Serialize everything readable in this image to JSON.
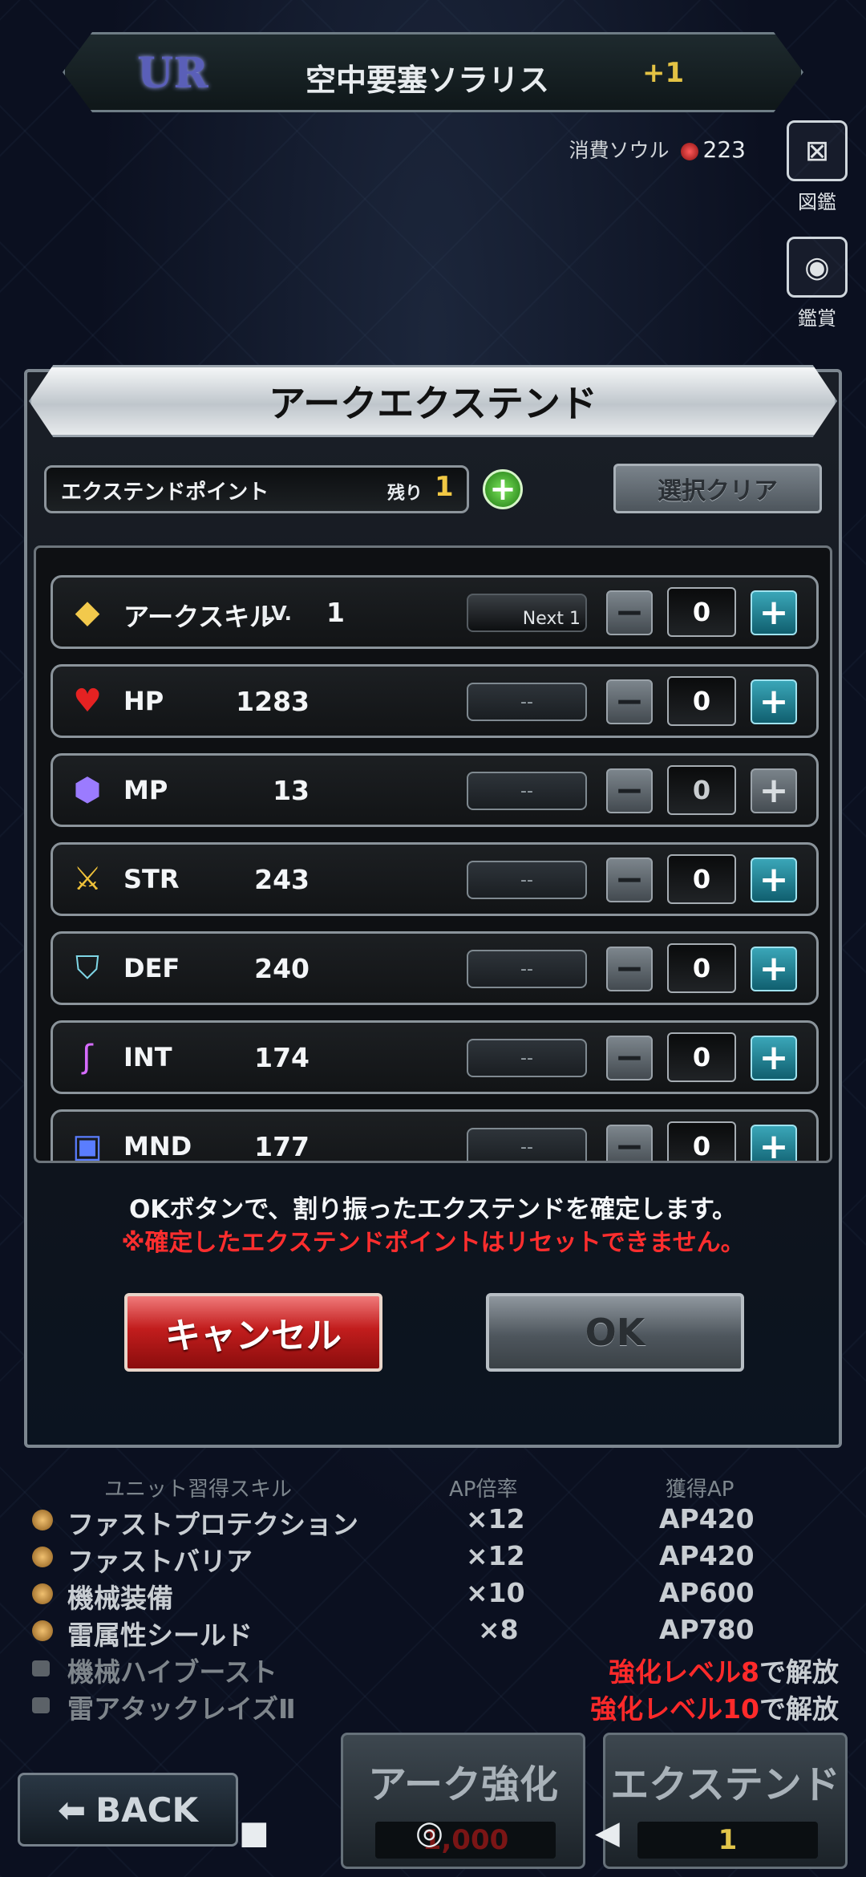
{
  "header": {
    "rarity": "UR",
    "unit_name": "空中要塞ソラリス",
    "plus_level": "+1",
    "soul_label": "消費ソウル",
    "soul_value": "223"
  },
  "side": {
    "encyclopedia_label": "図鑑",
    "appraisal_label": "鑑賞"
  },
  "modal": {
    "title": "アークエクステンド",
    "points_label": "エクステンドポイント",
    "remaining_label": "残り",
    "remaining_value": "1",
    "add_button": "+",
    "clear_button": "選択クリア",
    "rows": [
      {
        "icon": "diamond-icon",
        "name": "アークスキル",
        "lv_label": "LV.",
        "value": "1",
        "bar": "Next 1",
        "minus": "−",
        "count": "0",
        "plus": "+",
        "plus_enabled": true
      },
      {
        "icon": "heart-icon",
        "name": "HP",
        "value": "1283",
        "bar": "--",
        "minus": "−",
        "count": "0",
        "plus": "+",
        "plus_enabled": true
      },
      {
        "icon": "mp-orb-icon",
        "name": "MP",
        "value": "13",
        "bar": "--",
        "minus": "−",
        "count": "0",
        "plus": "+",
        "plus_enabled": false
      },
      {
        "icon": "sword-icon",
        "name": "STR",
        "value": "243",
        "bar": "--",
        "minus": "−",
        "count": "0",
        "plus": "+",
        "plus_enabled": true
      },
      {
        "icon": "shield-icon",
        "name": "DEF",
        "value": "240",
        "bar": "--",
        "minus": "−",
        "count": "0",
        "plus": "+",
        "plus_enabled": true
      },
      {
        "icon": "staff-icon",
        "name": "INT",
        "value": "174",
        "bar": "--",
        "minus": "−",
        "count": "0",
        "plus": "+",
        "plus_enabled": true
      },
      {
        "icon": "mnd-icon",
        "name": "MND",
        "value": "177",
        "bar": "--",
        "minus": "−",
        "count": "0",
        "plus": "+",
        "plus_enabled": true
      }
    ],
    "notice": "OKボタンで、割り振ったエクステンドを確定します。",
    "warning": "※確定したエクステンドポイントはリセットできません。",
    "cancel_button": "キャンセル",
    "ok_button": "OK"
  },
  "skills": {
    "headers": [
      "ユニット習得スキル",
      "AP倍率",
      "獲得AP"
    ],
    "rows": [
      {
        "name": "ファストプロテクション",
        "mult": "×12",
        "ap": "AP420"
      },
      {
        "name": "ファストバリア",
        "mult": "×12",
        "ap": "AP420"
      },
      {
        "name": "機械装備",
        "mult": "×10",
        "ap": "AP600"
      },
      {
        "name": "雷属性シールド",
        "mult": "×8",
        "ap": "AP780"
      }
    ],
    "locked": [
      {
        "name": "機械ハイブースト",
        "unlock_level": "強化レベル8",
        "unlock_suffix": "で解放"
      },
      {
        "name": "雷アタックレイズⅡ",
        "unlock_level": "強化レベル10",
        "unlock_suffix": "で解放"
      }
    ]
  },
  "bottom": {
    "back_label": "BACK",
    "ark_enhance_label": "アーク強化",
    "ark_enhance_value": "1,000",
    "extend_label": "エクステンド",
    "extend_value": "1"
  },
  "colors": {
    "accent_gold": "#f1c844",
    "warning_red": "#ff2e2e",
    "plus_teal": "#3aa6b8",
    "cancel_red": "#c21d1d"
  }
}
